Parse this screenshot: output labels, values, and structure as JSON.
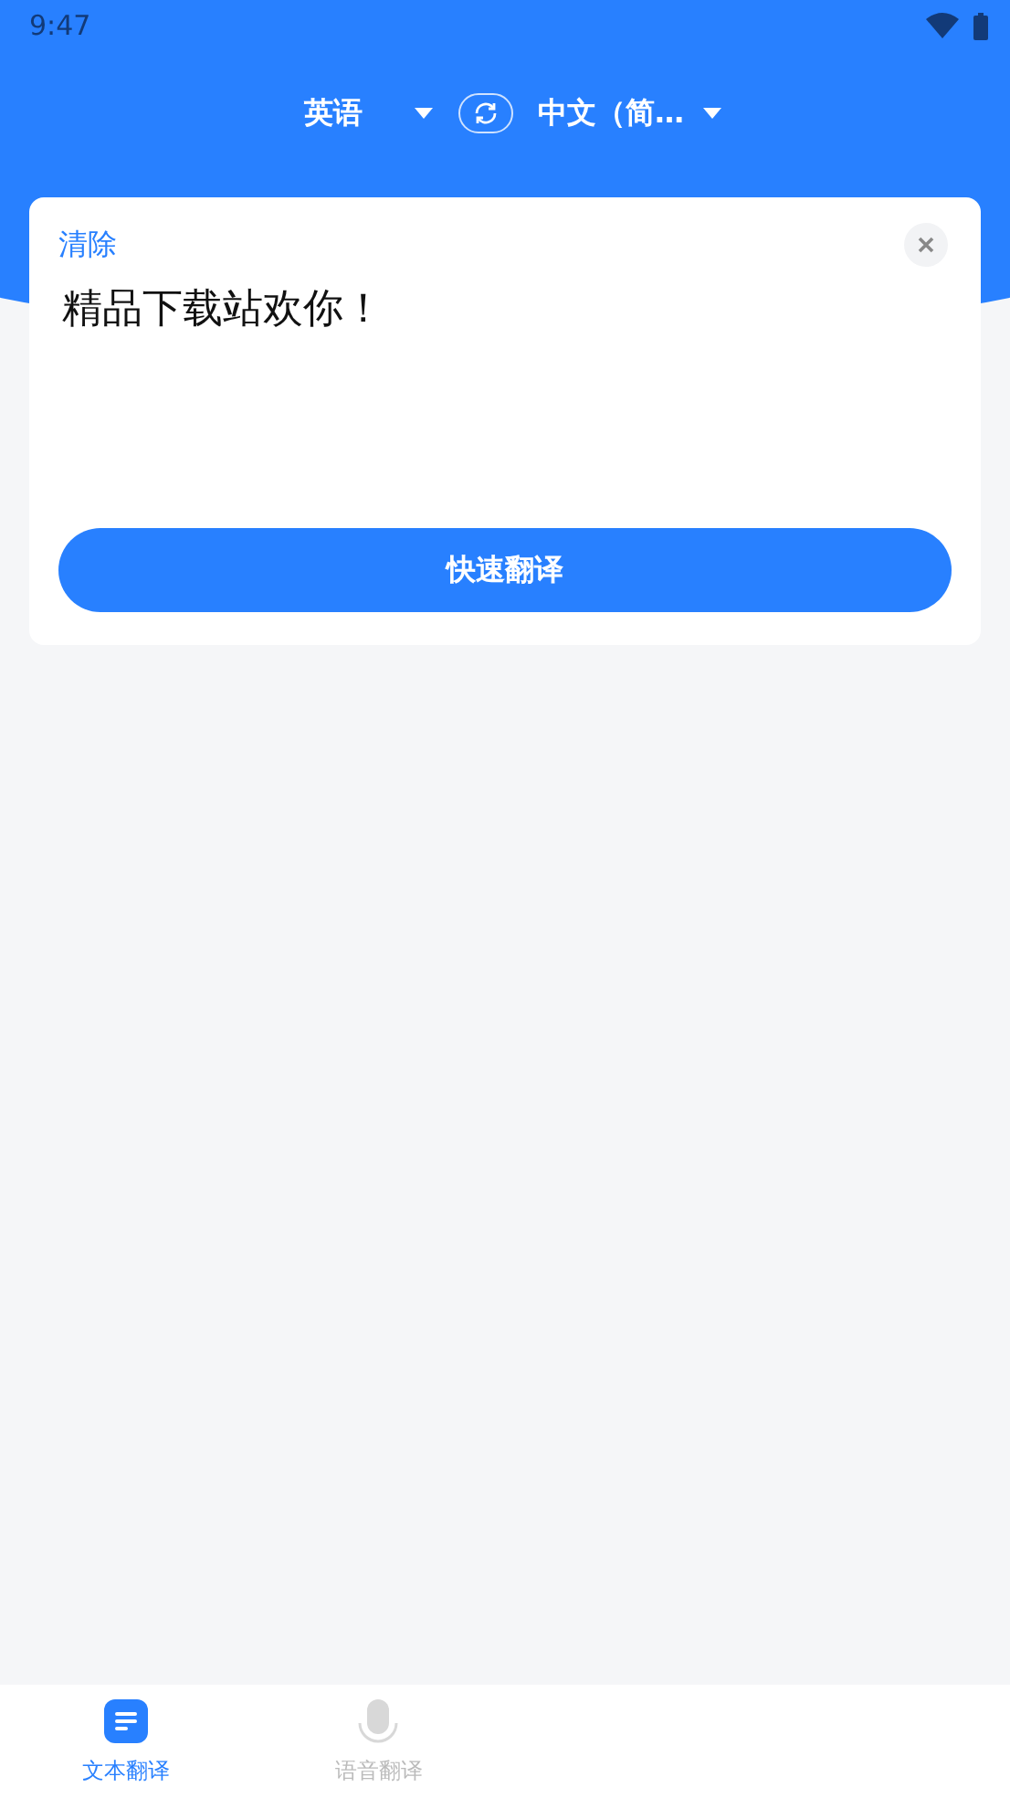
{
  "status_bar": {
    "time": "9:47"
  },
  "languages": {
    "source": "英语",
    "target": "中文（简…"
  },
  "input_card": {
    "clear_label": "清除",
    "text": "精品下载站欢你！",
    "translate_button": "快速翻译"
  },
  "tab_bar": [
    {
      "label": "文本翻译",
      "selected": true,
      "kind": "text"
    },
    {
      "label": "语音翻译",
      "selected": false,
      "kind": "voice"
    }
  ]
}
